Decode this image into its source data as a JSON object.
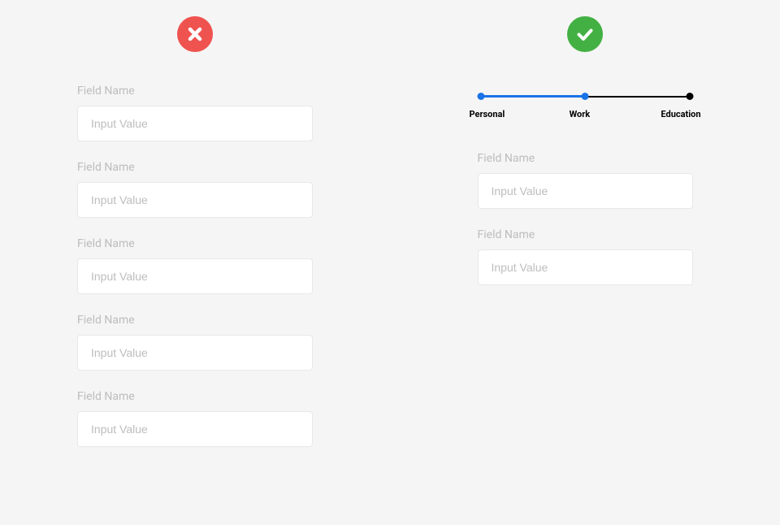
{
  "bad": {
    "fields": [
      {
        "label": "Field Name",
        "placeholder": "Input Value"
      },
      {
        "label": "Field Name",
        "placeholder": "Input Value"
      },
      {
        "label": "Field Name",
        "placeholder": "Input Value"
      },
      {
        "label": "Field Name",
        "placeholder": "Input Value"
      },
      {
        "label": "Field Name",
        "placeholder": "Input Value"
      }
    ]
  },
  "good": {
    "stepper": {
      "steps": [
        {
          "label": "Personal",
          "active": true
        },
        {
          "label": "Work",
          "active": true
        },
        {
          "label": "Education",
          "active": false
        }
      ]
    },
    "fields": [
      {
        "label": "Field Name",
        "placeholder": "Input Value"
      },
      {
        "label": "Field Name",
        "placeholder": "Input Value"
      }
    ]
  },
  "colors": {
    "bad": "#ef5350",
    "good": "#43b043",
    "accent": "#1a73e8"
  }
}
